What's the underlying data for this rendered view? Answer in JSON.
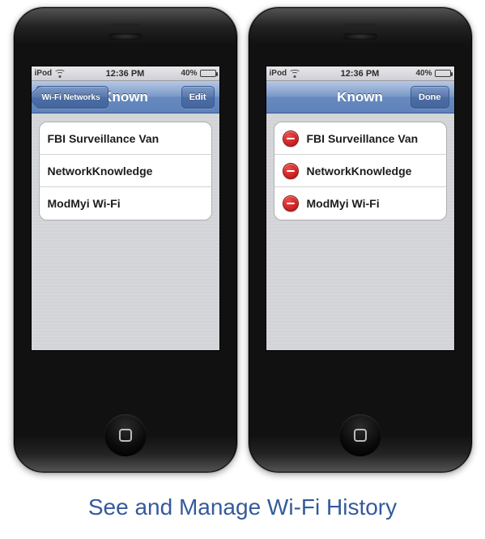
{
  "caption": "See and Manage Wi-Fi History",
  "statusbar": {
    "carrier": "iPod",
    "time": "12:36 PM",
    "battery_pct": "40%"
  },
  "left": {
    "back_label": "Wi-Fi Networks",
    "title": "Known",
    "right_button": "Edit",
    "networks": [
      {
        "name": "FBI Surveillance Van"
      },
      {
        "name": "NetworkKnowledge"
      },
      {
        "name": "ModMyi Wi-Fi"
      }
    ]
  },
  "right": {
    "title": "Known",
    "right_button": "Done",
    "networks": [
      {
        "name": "FBI Surveillance Van"
      },
      {
        "name": "NetworkKnowledge"
      },
      {
        "name": "ModMyi Wi-Fi"
      }
    ]
  }
}
